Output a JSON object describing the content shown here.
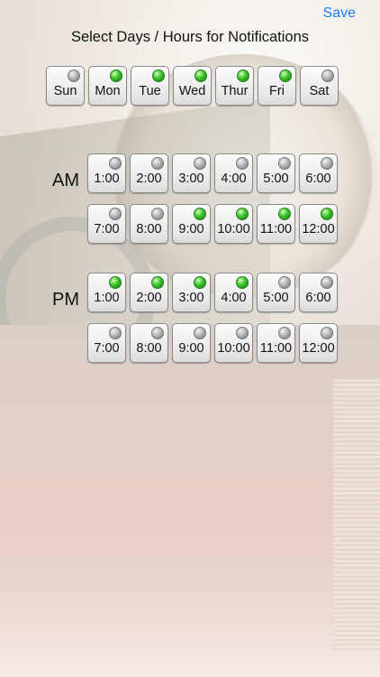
{
  "header": {
    "save_label": "Save",
    "title": "Select Days / Hours for Notifications"
  },
  "days": [
    {
      "label": "Sun",
      "on": false
    },
    {
      "label": "Mon",
      "on": true
    },
    {
      "label": "Tue",
      "on": true
    },
    {
      "label": "Wed",
      "on": true
    },
    {
      "label": "Thur",
      "on": true
    },
    {
      "label": "Fri",
      "on": true
    },
    {
      "label": "Sat",
      "on": false
    }
  ],
  "am": {
    "label": "AM",
    "hours": [
      {
        "label": "1:00",
        "on": false
      },
      {
        "label": "2:00",
        "on": false
      },
      {
        "label": "3:00",
        "on": false
      },
      {
        "label": "4:00",
        "on": false
      },
      {
        "label": "5:00",
        "on": false
      },
      {
        "label": "6:00",
        "on": false
      },
      {
        "label": "7:00",
        "on": false
      },
      {
        "label": "8:00",
        "on": false
      },
      {
        "label": "9:00",
        "on": true
      },
      {
        "label": "10:00",
        "on": true
      },
      {
        "label": "11:00",
        "on": true
      },
      {
        "label": "12:00",
        "on": true
      }
    ]
  },
  "pm": {
    "label": "PM",
    "hours": [
      {
        "label": "1:00",
        "on": true
      },
      {
        "label": "2:00",
        "on": true
      },
      {
        "label": "3:00",
        "on": true
      },
      {
        "label": "4:00",
        "on": true
      },
      {
        "label": "5:00",
        "on": false
      },
      {
        "label": "6:00",
        "on": false
      },
      {
        "label": "7:00",
        "on": false
      },
      {
        "label": "8:00",
        "on": false
      },
      {
        "label": "9:00",
        "on": false
      },
      {
        "label": "10:00",
        "on": false
      },
      {
        "label": "11:00",
        "on": false
      },
      {
        "label": "12:00",
        "on": false
      }
    ]
  },
  "colors": {
    "accent": "#1f7cf6",
    "indicator_on": "#39c42b",
    "indicator_off": "#a9a9a9"
  }
}
